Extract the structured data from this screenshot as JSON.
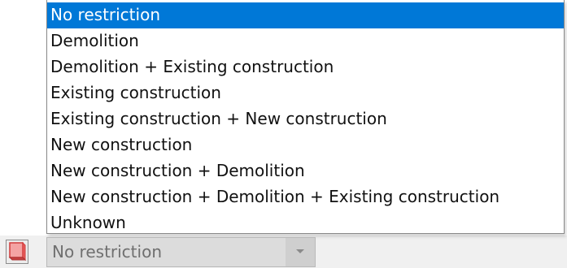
{
  "dropdown": {
    "options": [
      "No restriction",
      "Demolition",
      "Demolition + Existing construction",
      "Existing construction",
      "Existing construction + New construction",
      "New construction",
      "New construction + Demolition",
      "New construction + Demolition + Existing construction",
      "Unknown"
    ],
    "selected_index": 0
  },
  "combo": {
    "value": "No restriction",
    "icon": "chevron-down-icon"
  },
  "left_icon": {
    "icon": "phase-filter-icon"
  },
  "colors": {
    "selection": "#0078d7",
    "icon_accent": "#e85b5b"
  }
}
